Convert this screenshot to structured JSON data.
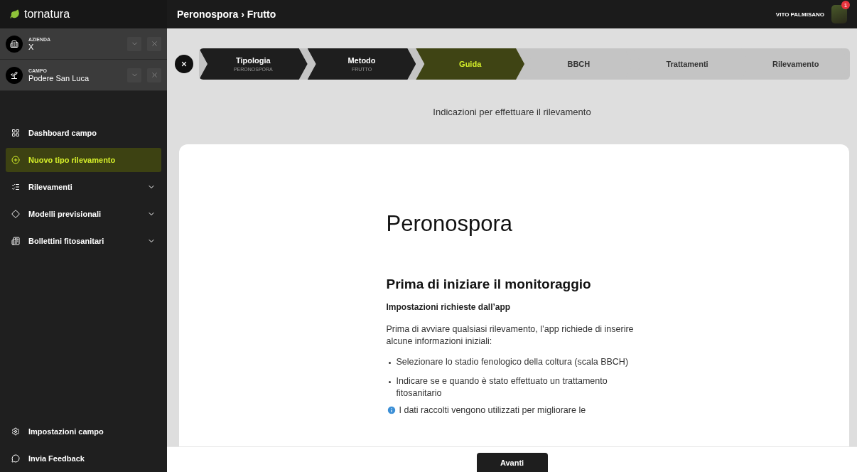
{
  "brand": "tornatura",
  "selectors": [
    {
      "caption": "AZIENDA",
      "value": "X"
    },
    {
      "caption": "CAMPO",
      "value": "Podere San Luca"
    }
  ],
  "nav": [
    {
      "label": "Dashboard campo",
      "selected": false,
      "expandable": false
    },
    {
      "label": "Nuovo tipo rilevamento",
      "selected": true,
      "expandable": false
    },
    {
      "label": "Rilevamenti",
      "selected": false,
      "expandable": true
    },
    {
      "label": "Modelli previsionali",
      "selected": false,
      "expandable": true
    },
    {
      "label": "Bollettini fitosanitari",
      "selected": false,
      "expandable": true
    }
  ],
  "footer_nav": [
    {
      "label": "Impostazioni campo"
    },
    {
      "label": "Invia Feedback"
    }
  ],
  "header": {
    "breadcrumb": "Peronospora › Frutto",
    "user": "VITO PALMISANO",
    "notifications": "1"
  },
  "steps": [
    {
      "label": "Tipologia",
      "sublabel": "PERONOSPORA",
      "completed": true,
      "selected": false
    },
    {
      "label": "Metodo",
      "sublabel": "FRUTTO",
      "completed": true,
      "selected": false
    },
    {
      "label": "Guida",
      "completed": false,
      "selected": true
    },
    {
      "label": "BBCH",
      "completed": false,
      "selected": false
    },
    {
      "label": "Trattamenti",
      "completed": false,
      "selected": false
    },
    {
      "label": "Rilevamento",
      "completed": false,
      "selected": false
    }
  ],
  "subtitle": "Indicazioni per effettuare il rilevamento",
  "guide": {
    "title": "Peronospora",
    "heading": "Prima di iniziare il monitoraggio",
    "subheading": "Impostazioni richieste dall’app",
    "paragraph": "Prima di avviare qualsiasi rilevamento, l’app richiede di inserire alcune informazioni iniziali:",
    "bullets": [
      "Selezionare lo stadio fenologico della coltura (scala BBCH)",
      "Indicare se e quando è stato effettuato un trattamento fitosanitario"
    ],
    "note": "I dati raccolti vengono utilizzati per migliorare le"
  },
  "next_button": "Avanti"
}
